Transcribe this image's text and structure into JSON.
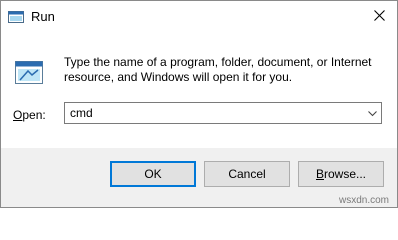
{
  "window": {
    "title": "Run",
    "app_icon": "run-app-icon",
    "close_icon": "close-icon"
  },
  "content": {
    "run_icon": "run-icon",
    "description_line1": "Type the name of a program, folder, document, or Internet",
    "description_line2": "resource, and Windows will open it for you.",
    "open_label_accel": "O",
    "open_label_rest": "pen:",
    "combo_value": "cmd",
    "combo_arrow_icon": "chevron-down-icon"
  },
  "buttons": {
    "ok_label": "OK",
    "cancel_label": "Cancel",
    "browse_accel": "B",
    "browse_rest": "rowse..."
  },
  "watermark": "wsxdn.com",
  "colors": {
    "accent": "#0078d7",
    "button_bar": "#f0f0f0",
    "button_face": "#e1e1e1"
  }
}
